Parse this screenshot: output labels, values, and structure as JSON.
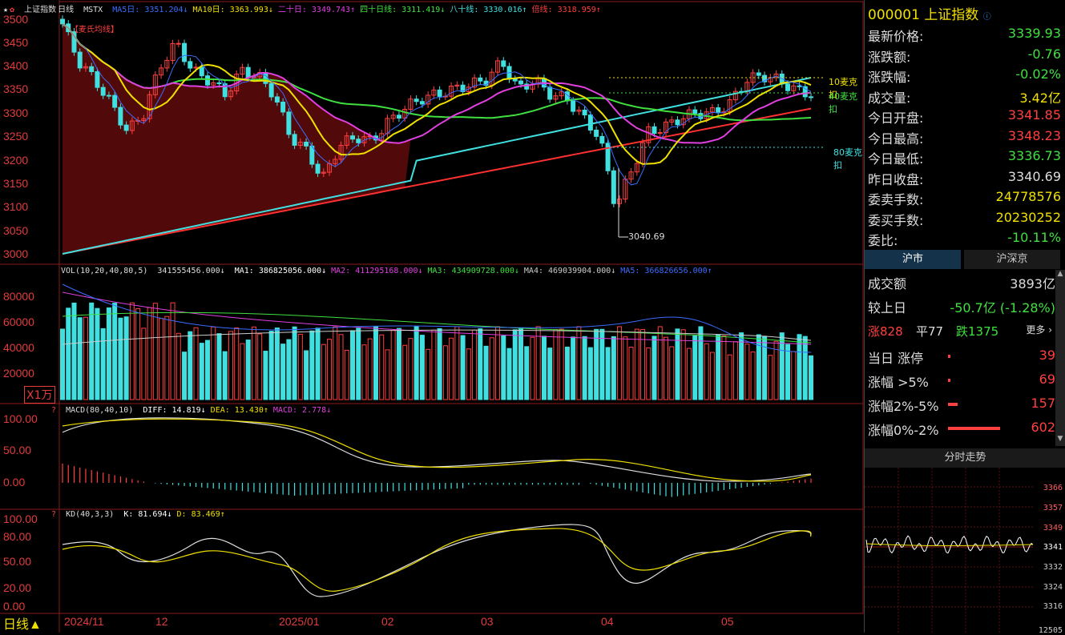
{
  "main": {
    "period_label": "日线▲",
    "overlay_tag": "【麦氏均线】",
    "header": {
      "star": "★",
      "index_name": "上证指数",
      "period": "日线",
      "indicator": "MSTX",
      "items": [
        {
          "label": "MA5日:",
          "value": "3351.204↓",
          "color": "#3a6cff"
        },
        {
          "label": "MA10日:",
          "value": "3363.993↓",
          "color": "#f0e000"
        },
        {
          "label": "二十日:",
          "value": "3349.743↑",
          "color": "#e040e0"
        },
        {
          "label": "四十日线:",
          "value": "3311.419↓",
          "color": "#40e040"
        },
        {
          "label": "八十线:",
          "value": "3330.016↑",
          "color": "#40e0e0"
        },
        {
          "label": "倍线:",
          "value": "3318.959↑",
          "color": "#ff4040"
        }
      ]
    },
    "price_axis": [
      "3500",
      "3450",
      "3400",
      "3350",
      "3300",
      "3250",
      "3200",
      "3150",
      "3100",
      "3050",
      "3000"
    ],
    "annotations": {
      "low_label": "3040.69",
      "line_10": "10麦克扣",
      "line_40": "40麦克扣",
      "line_80": "80麦克扣"
    },
    "date_labels": [
      "2024/11",
      "12",
      "2025/01",
      "02",
      "03",
      "04",
      "05"
    ]
  },
  "volume": {
    "header": "VOL(10,20,40,80,5)",
    "value": "341555456.000↓",
    "items": [
      {
        "label": "MA1:",
        "value": "386825056.000↓",
        "color": "#ffffff"
      },
      {
        "label": "MA2:",
        "value": "411295168.000↓",
        "color": "#e040e0"
      },
      {
        "label": "MA3:",
        "value": "434909728.000↓",
        "color": "#40e040"
      },
      {
        "label": "MA4:",
        "value": "469039904.000↓",
        "color": "#cccccc"
      },
      {
        "label": "MA5:",
        "value": "366826656.000↑",
        "color": "#3a6cff"
      }
    ],
    "axis": [
      "80000",
      "60000",
      "40000",
      "20000"
    ],
    "unit": "X1万"
  },
  "macd": {
    "header": "MACD(80,40,10)",
    "items": [
      {
        "label": "DIFF:",
        "value": "14.819↓",
        "color": "#ffffff"
      },
      {
        "label": "DEA:",
        "value": "13.430↑",
        "color": "#f0e000"
      },
      {
        "label": "MACD:",
        "value": "2.778↓",
        "color": "#e040e0"
      }
    ],
    "axis": [
      "100.00",
      "50.00",
      "0.00"
    ]
  },
  "kd": {
    "header": "KD(40,3,3)",
    "items": [
      {
        "label": "K:",
        "value": "81.694↓",
        "color": "#ffffff"
      },
      {
        "label": "D:",
        "value": "83.469↑",
        "color": "#f0e000"
      }
    ],
    "axis": [
      "100.00",
      "80.00",
      "50.00",
      "20.00",
      "0.00"
    ]
  },
  "side": {
    "code": "000001",
    "name": "上证指数",
    "quote": [
      {
        "k": "最新价格:",
        "v": "3339.93",
        "color": "#40e040"
      },
      {
        "k": "涨跌额:",
        "v": "-0.76",
        "color": "#40e040"
      },
      {
        "k": "涨跌幅:",
        "v": "-0.02%",
        "color": "#40e040"
      },
      {
        "k": "成交量:",
        "v": "3.42亿",
        "color": "#f0e000"
      },
      {
        "k": "今日开盘:",
        "v": "3341.85",
        "color": "#ff4040"
      },
      {
        "k": "今日最高:",
        "v": "3348.23",
        "color": "#ff4040"
      },
      {
        "k": "今日最低:",
        "v": "3336.73",
        "color": "#40e040"
      },
      {
        "k": "昨日收盘:",
        "v": "3340.69",
        "color": "#dddddd"
      },
      {
        "k": "委卖手数:",
        "v": "24778576",
        "color": "#f0e000"
      },
      {
        "k": "委买手数:",
        "v": "20230252",
        "color": "#f0e000"
      },
      {
        "k": "委比:",
        "v": "-10.11%",
        "color": "#40e040"
      }
    ],
    "tabs": [
      "沪市",
      "沪深京"
    ],
    "turnover_label": "成交额",
    "turnover_value": "3893亿",
    "vs_label": "较上日",
    "vs_value": "-50.7亿 (-1.28%)",
    "up_count": "涨828",
    "flat_count": "平77",
    "down_count": "跌1375",
    "more": "更多 ›",
    "breadth": [
      {
        "k": "当日 涨停",
        "v": "39",
        "bar": 0.02
      },
      {
        "k": "涨幅 >5%",
        "v": "69",
        "bar": 0.03
      },
      {
        "k": "涨幅2%-5%",
        "v": "157",
        "bar": 0.12
      },
      {
        "k": "涨幅0%-2%",
        "v": "602",
        "bar": 0.65
      }
    ],
    "intraday_title": "分时走势",
    "intraday_axis": [
      "3366",
      "3357",
      "3349",
      "3341",
      "3332",
      "3324",
      "3316",
      "12505"
    ]
  }
}
